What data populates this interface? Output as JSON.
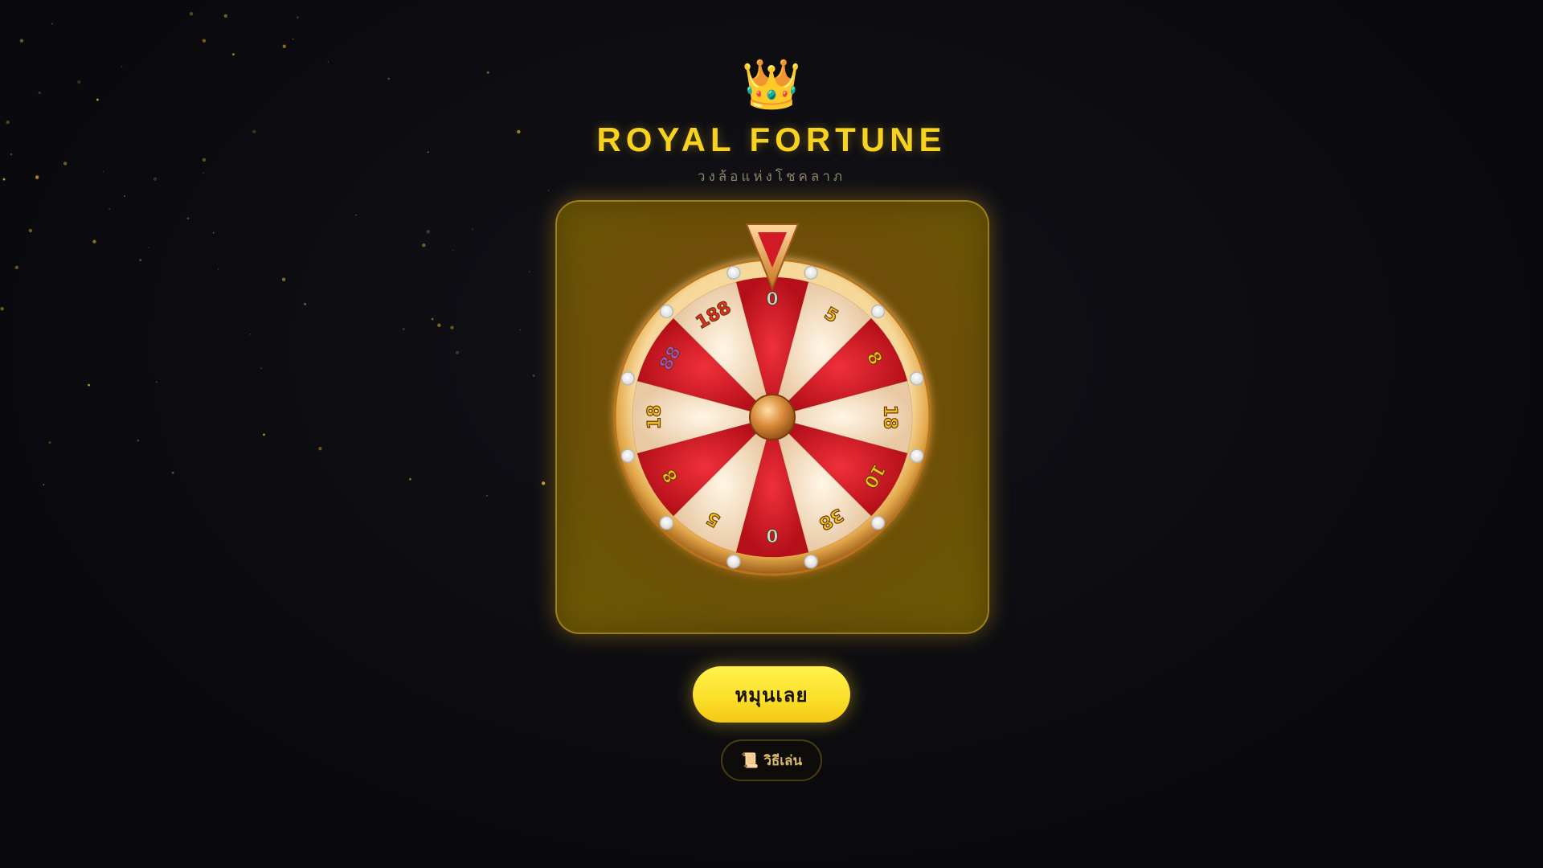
{
  "header": {
    "crown_icon": "👑",
    "title": "ROYAL FORTUNE",
    "subtitle": "วงล้อแห่งโชคลาภ"
  },
  "wheel": {
    "segments": [
      "0",
      "5",
      "8",
      "18",
      "10",
      "38",
      "0",
      "5",
      "8",
      "18",
      "88",
      "188"
    ],
    "segment_colors": [
      "#d11a25",
      "#f3dcc0"
    ],
    "label_colors": {
      "0": "#c9d3de",
      "5": "#f2c21c",
      "8": "#f2c21c",
      "18": "#f2c21c",
      "10": "#f2c21c",
      "38": "#f2c21c",
      "88": "#b24ad8",
      "188": "#ef2a2a"
    },
    "pointer_icon": "pointer-triangle-icon",
    "rim_color": "#e3a84a",
    "bulb_count": 12
  },
  "controls": {
    "spin_label": "หมุนเลย",
    "howto_icon": "📜",
    "howto_label": "วิธีเล่น"
  },
  "colors": {
    "accent": "#f7d21f",
    "background": "#0b0b0f"
  }
}
